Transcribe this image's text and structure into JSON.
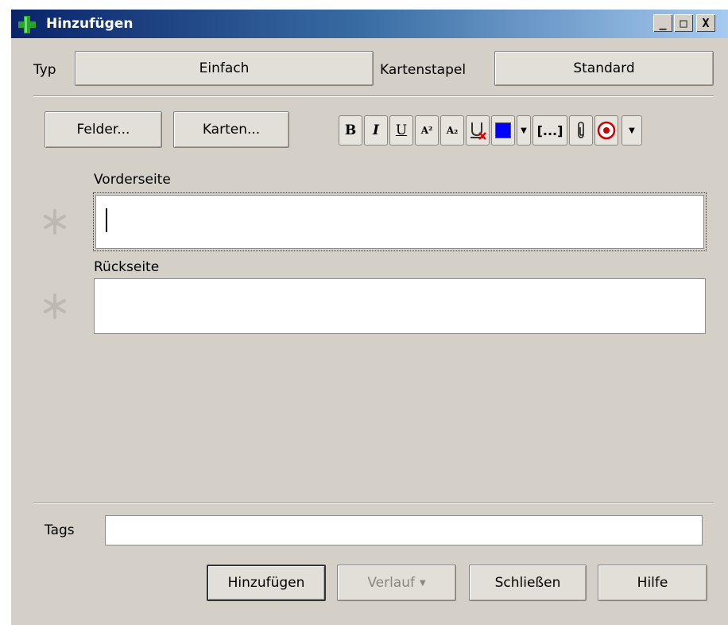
{
  "window": {
    "title": "Hinzufügen",
    "controls": {
      "minimize": "_",
      "maximize": "□",
      "close": "X"
    }
  },
  "top_row": {
    "type_label": "Typ",
    "type_value": "Einfach",
    "deck_label": "Kartenstapel",
    "deck_value": "Standard"
  },
  "editor_buttons": {
    "fields": "Felder...",
    "cards": "Karten..."
  },
  "toolbar": {
    "bold": "B",
    "italic": "I",
    "underline": "U",
    "superscript": "A²",
    "subscript": "A₂",
    "cloze": "[...]",
    "icons": [
      "format-bold-icon",
      "format-italic-icon",
      "format-underline-icon",
      "superscript-icon",
      "subscript-icon",
      "clear-format-icon",
      "text-color-icon",
      "color-dropdown-icon",
      "cloze-icon",
      "attach-icon",
      "record-icon",
      "more-dropdown-icon"
    ],
    "text_color": "#0000ff"
  },
  "fields": [
    {
      "label": "Vorderseite",
      "value": ""
    },
    {
      "label": "Rückseite",
      "value": ""
    }
  ],
  "tags": {
    "label": "Tags",
    "value": ""
  },
  "bottom_buttons": {
    "add": "Hinzufügen",
    "history": "Verlauf",
    "close": "Schließen",
    "help": "Hilfe"
  }
}
